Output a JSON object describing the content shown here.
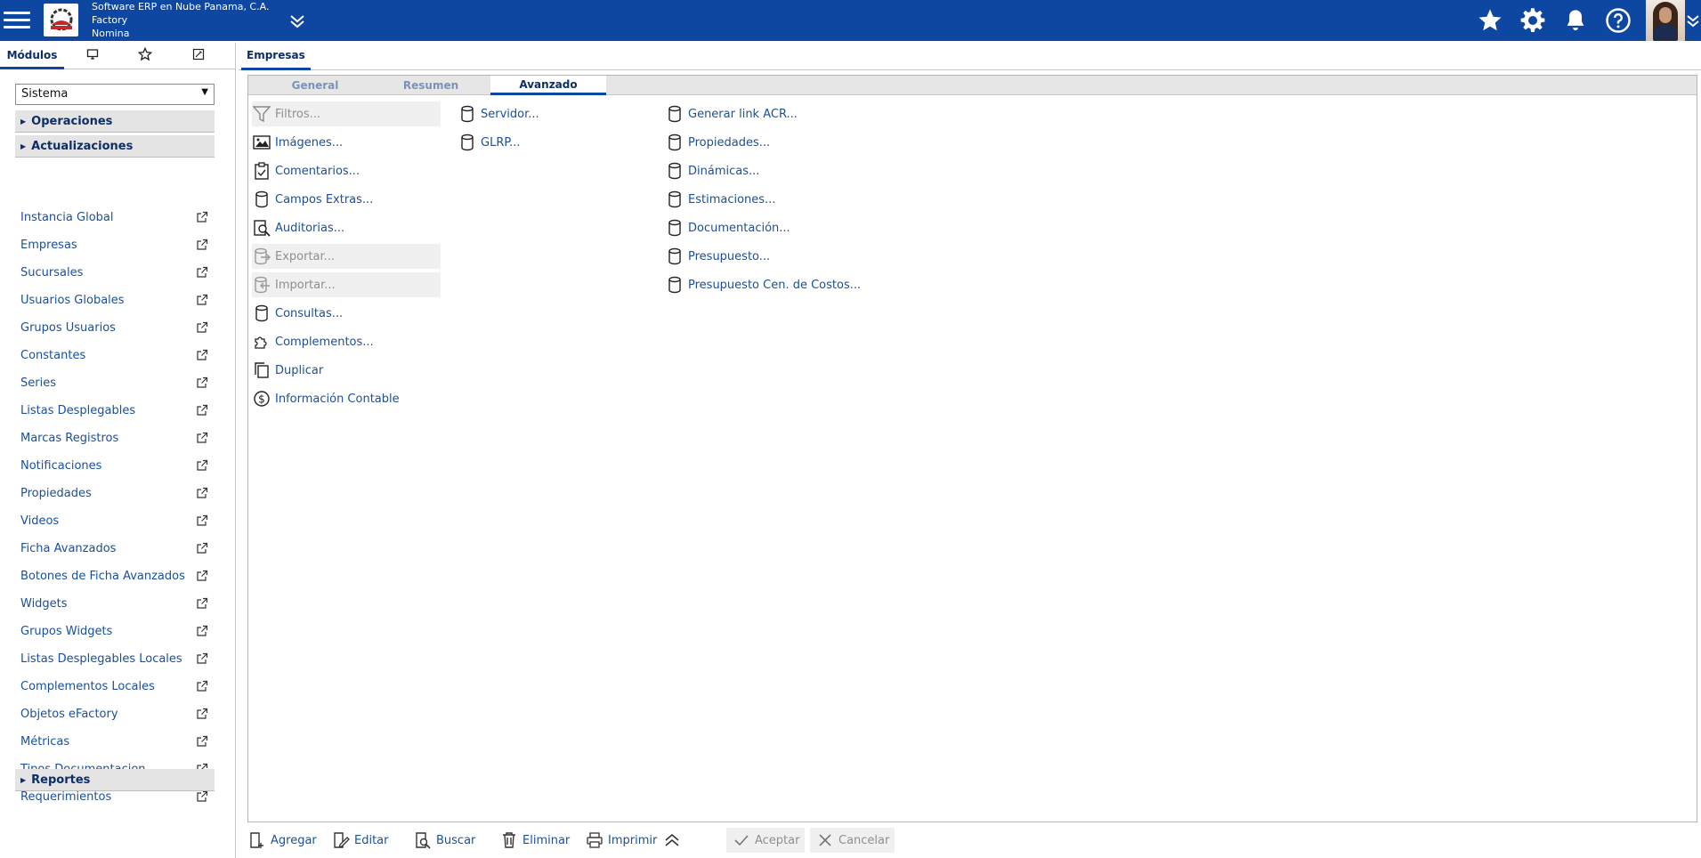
{
  "header": {
    "company_name": "Software ERP en Nube Panama, C.A.",
    "module_line1": "Factory",
    "module_line2": "Nomina"
  },
  "left_tabs": {
    "modules_label": "Módulos"
  },
  "module_select": {
    "value": "Sistema"
  },
  "sections": {
    "operaciones": "Operaciones",
    "actualizaciones": "Actualizaciones",
    "reportes": "Reportes"
  },
  "menu_items": [
    "Instancia Global",
    "Empresas",
    "Sucursales",
    "Usuarios Globales",
    "Grupos Usuarios",
    "Constantes",
    "Series",
    "Listas Desplegables",
    "Marcas Registros",
    "Notificaciones",
    "Propiedades",
    "Videos",
    "Ficha Avanzados",
    "Botones de Ficha Avanzados",
    "Widgets",
    "Grupos Widgets",
    "Listas Desplegables Locales",
    "Complementos Locales",
    "Objetos eFactory",
    "Métricas",
    "Tipos Documentacion",
    "Requerimientos"
  ],
  "main_tab": "Empresas",
  "sub_tabs": {
    "general": "General",
    "resumen": "Resumen",
    "avanzado": "Avanzado"
  },
  "actions_col1": [
    {
      "label": "Filtros...",
      "icon": "filter-icon",
      "disabled": true
    },
    {
      "label": "Imágenes...",
      "icon": "image-icon",
      "disabled": false
    },
    {
      "label": "Comentarios...",
      "icon": "clipboard-check-icon",
      "disabled": false
    },
    {
      "label": "Campos Extras...",
      "icon": "database-icon",
      "disabled": false
    },
    {
      "label": "Auditorias...",
      "icon": "audit-search-icon",
      "disabled": false
    },
    {
      "label": "Exportar...",
      "icon": "database-export-icon",
      "disabled": true
    },
    {
      "label": "Importar...",
      "icon": "database-import-icon",
      "disabled": true
    },
    {
      "label": "Consultas...",
      "icon": "database-icon",
      "disabled": false
    },
    {
      "label": "Complementos...",
      "icon": "puzzle-icon",
      "disabled": false
    },
    {
      "label": "Duplicar",
      "icon": "copy-icon",
      "disabled": false
    },
    {
      "label": "Información Contable",
      "icon": "dollar-circle-icon",
      "disabled": false
    }
  ],
  "actions_col2": [
    {
      "label": "Servidor...",
      "icon": "database-icon"
    },
    {
      "label": "GLRP...",
      "icon": "database-icon"
    }
  ],
  "actions_col3": [
    {
      "label": "Generar link ACR...",
      "icon": "database-icon"
    },
    {
      "label": "Propiedades...",
      "icon": "database-icon"
    },
    {
      "label": "Dinámicas...",
      "icon": "database-icon"
    },
    {
      "label": "Estimaciones...",
      "icon": "database-icon"
    },
    {
      "label": "Documentación...",
      "icon": "database-icon"
    },
    {
      "label": "Presupuesto...",
      "icon": "database-icon"
    },
    {
      "label": "Presupuesto Cen. de Costos...",
      "icon": "database-icon"
    }
  ],
  "footer": {
    "agregar": "Agregar",
    "editar": "Editar",
    "buscar": "Buscar",
    "eliminar": "Eliminar",
    "imprimir": "Imprimir",
    "aceptar": "Aceptar",
    "cancelar": "Cancelar"
  },
  "colors": {
    "header_bg": "#0d47a1",
    "link": "#1a4f9c",
    "disabled_bg": "#f0f0f0"
  }
}
